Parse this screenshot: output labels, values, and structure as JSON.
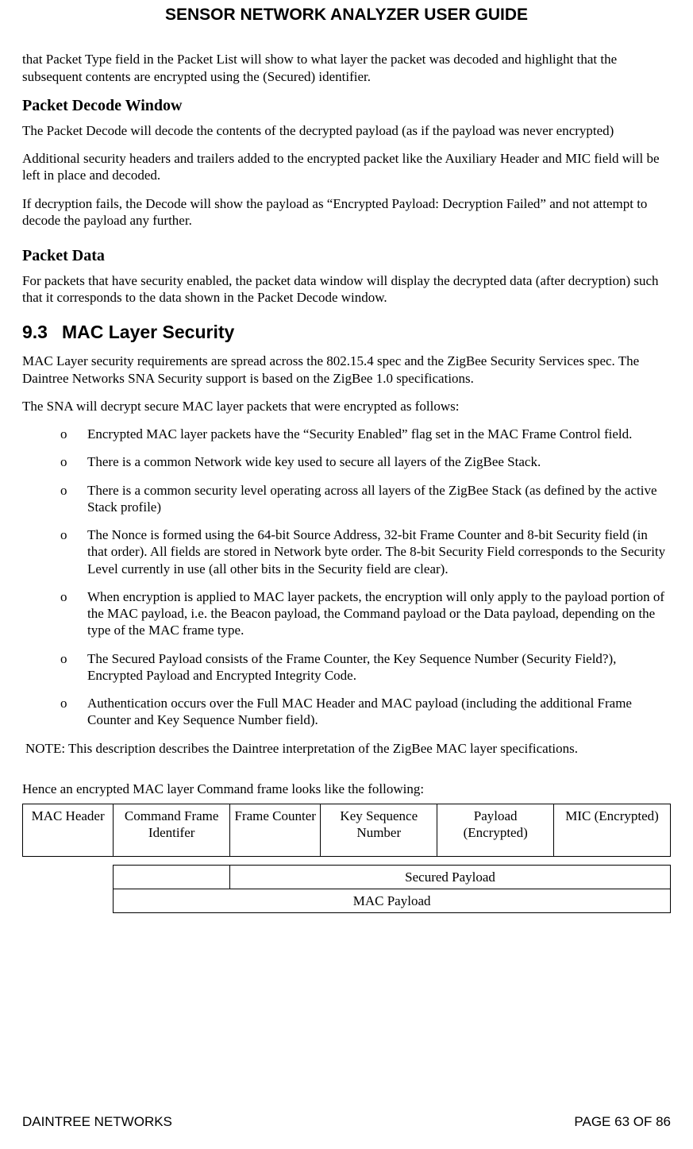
{
  "doc_title": "SENSOR NETWORK ANALYZER USER GUIDE",
  "intro_para": "that Packet Type field in the Packet List will show to what layer the packet was decoded and highlight that the subsequent contents are encrypted using the (Secured) identifier.",
  "sec_pdw": {
    "heading": "Packet Decode Window",
    "p1": "The Packet Decode will decode the contents of the decrypted payload (as if the payload was never encrypted)",
    "p2": "Additional security headers and trailers added to the encrypted packet like the Auxiliary Header and MIC field will be left in place and decoded.",
    "p3": "If decryption fails, the Decode will show the payload as “Encrypted Payload: Decryption Failed” and not attempt to decode the payload any further."
  },
  "sec_pd": {
    "heading": "Packet Data",
    "p1": "For packets that have security enabled, the packet data window will display the decrypted data (after decryption) such that it corresponds to the data shown in the Packet Decode window."
  },
  "sec_93": {
    "number": "9.3",
    "title": "MAC Layer Security",
    "p1": "MAC Layer security requirements are spread across the 802.15.4 spec and the ZigBee Security Services spec. The Daintree Networks SNA Security support is based on the ZigBee 1.0 specifications.",
    "p2": "The SNA will decrypt secure MAC layer packets that were encrypted as follows:",
    "bullets": [
      "Encrypted MAC layer packets have the “Security Enabled” flag set in the MAC Frame Control field.",
      "There is a common Network wide key used to secure all layers of the ZigBee Stack.",
      "There is a common security level operating across all layers of the ZigBee Stack (as defined by the active Stack profile)",
      "The Nonce is formed using the 64-bit Source Address, 32-bit Frame Counter and 8-bit Security field (in that order). All fields are stored in Network byte order. The 8-bit Security Field corresponds to the Security Level currently in use (all other bits in the Security field are clear).",
      "When encryption is applied to MAC layer packets, the encryption will only apply to the payload portion of the MAC payload, i.e. the Beacon payload, the Command payload or the Data payload, depending on the type of the MAC frame type.",
      "The Secured Payload consists of the Frame Counter, the Key Sequence Number (Security Field?), Encrypted Payload and Encrypted Integrity Code.",
      "Authentication occurs over the Full MAC Header and MAC payload (including the additional Frame Counter and Key Sequence Number field)."
    ],
    "note": "NOTE: This description describes the Daintree interpretation of the ZigBee MAC layer specifications.",
    "leadin": "Hence an encrypted MAC layer Command frame looks like the following:"
  },
  "table": {
    "row1": [
      "MAC Header",
      "Command Frame Identifer",
      "Frame Counter",
      "Key Sequence Number",
      "Payload (Encrypted)",
      "MIC (Encrypted)"
    ],
    "secured": "Secured Payload",
    "macpayload": "MAC Payload"
  },
  "footer": {
    "left": "DAINTREE NETWORKS",
    "right": "PAGE 63 OF 86"
  }
}
